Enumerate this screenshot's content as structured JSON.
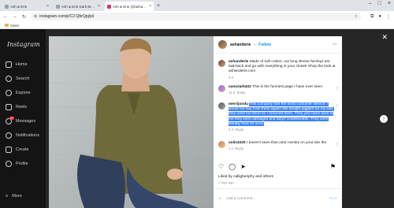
{
  "browser": {
    "tabs": [
      {
        "label": "Ash & Erie",
        "active": false
      },
      {
        "label": "Ash & Erie Dark Brown Bouncer",
        "active": false
      },
      {
        "label": "Ash & Erie (@ashanderie) • Inst",
        "active": true
      }
    ],
    "new_tab": "+",
    "url": "instagram.com/p/C2-QbrQpj/pi/",
    "bookmark_folder": "Sales"
  },
  "sidebar": {
    "logo": "Instagram",
    "nav": [
      {
        "label": "Home",
        "icon": "home-icon"
      },
      {
        "label": "Search",
        "icon": "search-icon"
      },
      {
        "label": "Explore",
        "icon": "compass-icon"
      },
      {
        "label": "Reels",
        "icon": "reels-icon"
      },
      {
        "label": "Messages",
        "icon": "messenger-icon",
        "badge": "17"
      },
      {
        "label": "Notifications",
        "icon": "heart-icon"
      },
      {
        "label": "Create",
        "icon": "plus-icon"
      },
      {
        "label": "Profile",
        "icon": "profile-icon"
      },
      {
        "label": "More",
        "icon": "menu-icon"
      }
    ]
  },
  "post": {
    "username": "ashanderie",
    "follow_label": "Follow",
    "caption_user": "ashanderie",
    "caption": "Made of soft cotton, our long sleeve henleys are laid-back and go with everything in your closet! Shop the look at ashanderie.com",
    "caption_age": "2 d",
    "comments": [
      {
        "user": "samclark402",
        "text": "This is the funniest page I have ever seen.",
        "age": "12 d",
        "reply": "Reply"
      },
      {
        "user": "merrijondu",
        "text": "This company has the word customer service. I would not buy from them again! We bought joggers for my son, they were too short so I returned them. They just came back to me they were damaged and dirty!! Unbelievable. They were literally tried on once.",
        "age": "2 d",
        "reply": "Reply"
      },
      {
        "user": "solis3220",
        "text": "I haven't seen that color Henley on your site tho",
        "age": "2 d",
        "reply": "Reply"
      }
    ],
    "liked_by": "Liked by calligheriphy and others",
    "posted_ago": "2 days ago",
    "add_comment_placeholder": "Add a comment...",
    "post_button": "Post"
  }
}
